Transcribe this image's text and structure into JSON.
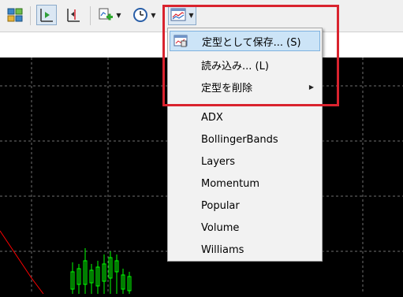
{
  "toolbar": {
    "buttons": [
      {
        "name": "tile-windows-icon"
      },
      {
        "name": "chart-shift-icon"
      },
      {
        "name": "auto-scroll-icon"
      },
      {
        "name": "add-indicator-icon"
      },
      {
        "name": "periods-clock-icon"
      },
      {
        "name": "templates-icon"
      }
    ]
  },
  "menu": {
    "top_items": [
      {
        "label": "定型として保存... (S)"
      },
      {
        "label": "読み込み... (L)"
      },
      {
        "label": "定型を削除"
      }
    ],
    "templates": [
      "ADX",
      "BollingerBands",
      "Layers",
      "Momentum",
      "Popular",
      "Volume",
      "Williams"
    ]
  },
  "colors": {
    "highlight_border": "#d9232e",
    "menu_hover": "#cce4f7",
    "candle_green": "#00ff00",
    "trend_red": "#ff0000"
  }
}
